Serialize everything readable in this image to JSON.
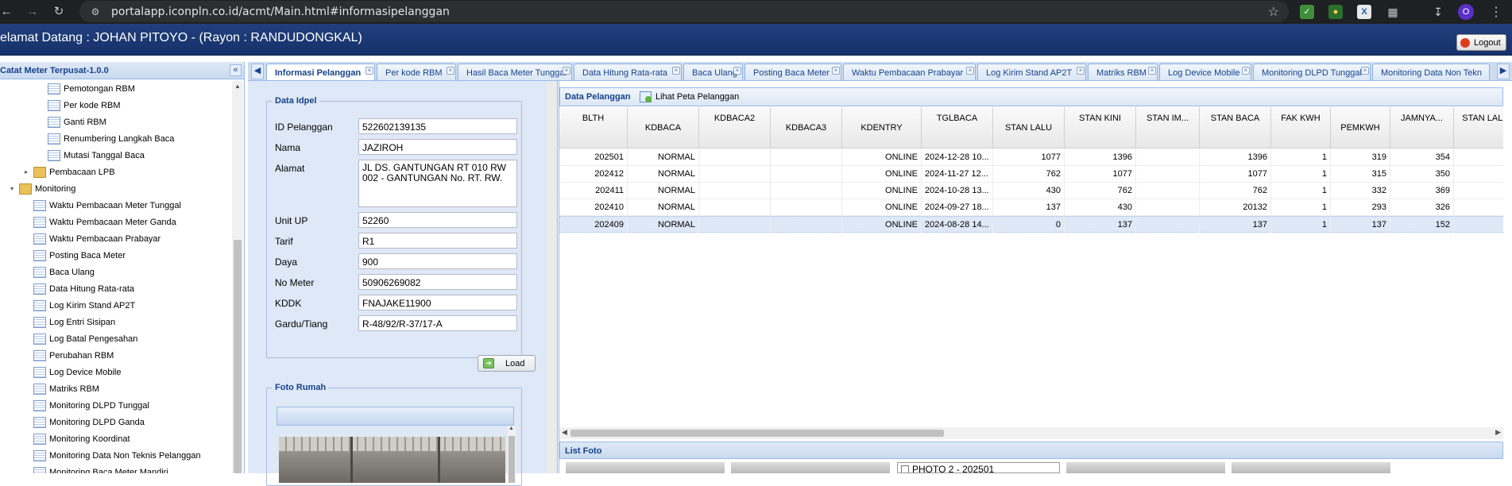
{
  "browser": {
    "url": "portalapp.iconpln.co.id/acmt/Main.html#informasipelanggan",
    "profile_initial": "O",
    "nav_icons": [
      "back-icon",
      "forward-icon",
      "reload-icon"
    ],
    "extension_icons": [
      "shield-extension-icon",
      "color-extension-icon",
      "excel-extension-icon",
      "puzzle-extension-icon",
      "download-icon"
    ]
  },
  "header": {
    "welcome": "elamat Datang : JOHAN PITOYO - (Rayon : RANDUDONGKAL)",
    "logout_label": "Logout"
  },
  "sidebar": {
    "title": "Catat Meter Terpusat-1.0.0",
    "items": [
      {
        "label": "Pemotongan RBM",
        "level": 2,
        "type": "leaf"
      },
      {
        "label": "Per kode RBM",
        "level": 2,
        "type": "leaf"
      },
      {
        "label": "Ganti RBM",
        "level": 2,
        "type": "leaf"
      },
      {
        "label": "Renumbering Langkah Baca",
        "level": 2,
        "type": "leaf"
      },
      {
        "label": "Mutasi Tanggal Baca",
        "level": 2,
        "type": "leaf"
      },
      {
        "label": "Pembacaan LPB",
        "level": 1,
        "type": "folder-collapsed"
      },
      {
        "label": "Monitoring",
        "level": 0,
        "type": "folder-open"
      },
      {
        "label": "Waktu Pembacaan Meter Tunggal",
        "level": 1,
        "type": "leaf"
      },
      {
        "label": "Waktu Pembacaan Meter Ganda",
        "level": 1,
        "type": "leaf"
      },
      {
        "label": "Waktu Pembacaan Prabayar",
        "level": 1,
        "type": "leaf"
      },
      {
        "label": "Posting Baca Meter",
        "level": 1,
        "type": "leaf"
      },
      {
        "label": "Baca Ulang",
        "level": 1,
        "type": "leaf"
      },
      {
        "label": "Data Hitung Rata-rata",
        "level": 1,
        "type": "leaf"
      },
      {
        "label": "Log Kirim Stand AP2T",
        "level": 1,
        "type": "leaf"
      },
      {
        "label": "Log Entri Sisipan",
        "level": 1,
        "type": "leaf"
      },
      {
        "label": "Log Batal Pengesahan",
        "level": 1,
        "type": "leaf"
      },
      {
        "label": "Perubahan RBM",
        "level": 1,
        "type": "leaf"
      },
      {
        "label": "Log Device Mobile",
        "level": 1,
        "type": "leaf"
      },
      {
        "label": "Matriks RBM",
        "level": 1,
        "type": "leaf"
      },
      {
        "label": "Monitoring DLPD Tunggal",
        "level": 1,
        "type": "leaf"
      },
      {
        "label": "Monitoring DLPD Ganda",
        "level": 1,
        "type": "leaf"
      },
      {
        "label": "Monitoring Koordinat",
        "level": 1,
        "type": "leaf"
      },
      {
        "label": "Monitoring Data Non Teknis Pelanggan",
        "level": 1,
        "type": "leaf"
      },
      {
        "label": "Monitoring Baca Meter Mandiri",
        "level": 1,
        "type": "leaf"
      }
    ]
  },
  "tabs": [
    {
      "label": "Informasi Pelanggan",
      "active": true
    },
    {
      "label": "Per kode RBM",
      "active": false
    },
    {
      "label": "Hasil Baca Meter Tunggal",
      "active": false
    },
    {
      "label": "Data Hitung Rata-rata",
      "active": false
    },
    {
      "label": "Baca Ulang",
      "active": false
    },
    {
      "label": "Posting Baca Meter",
      "active": false
    },
    {
      "label": "Waktu Pembacaan Prabayar",
      "active": false
    },
    {
      "label": "Log Kirim Stand AP2T",
      "active": false
    },
    {
      "label": "Matriks RBM",
      "active": false
    },
    {
      "label": "Log Device Mobile",
      "active": false
    },
    {
      "label": "Monitoring DLPD Tunggal",
      "active": false
    },
    {
      "label": "Monitoring Data Non Tekn",
      "active": false
    }
  ],
  "data_idpel": {
    "legend": "Data Idpel",
    "fields": [
      {
        "label": "ID Pelanggan",
        "value": "522602139135"
      },
      {
        "label": "Nama",
        "value": "JAZIROH"
      },
      {
        "label": "Alamat",
        "value": "JL DS. GANTUNGAN RT 010 RW 002 - GANTUNGAN No.   RT. RW."
      },
      {
        "label": "Unit UP",
        "value": "52260"
      },
      {
        "label": "Tarif",
        "value": "R1"
      },
      {
        "label": "Daya",
        "value": "900"
      },
      {
        "label": "No Meter",
        "value": "50906269082"
      },
      {
        "label": "KDDK",
        "value": "FNAJAKE11900"
      },
      {
        "label": "Gardu/Tiang",
        "value": "R-48/92/R-37/17-A"
      }
    ],
    "load_label": "Load"
  },
  "foto_rumah": {
    "legend": "Foto Rumah"
  },
  "grid": {
    "title": "Data Pelanggan",
    "map_button": "Lihat Peta Pelanggan",
    "columns": [
      "BLTH",
      "KDBACA",
      "KDBACA2",
      "KDBACA3",
      "KDENTRY",
      "TGLBACA",
      "STAN LALU",
      "STAN KINI",
      "STAN IM...",
      "STAN BACA",
      "FAK KWH",
      "PEMKWH",
      "JAMNYA...",
      "STAN LALU W"
    ],
    "rows": [
      [
        "202501",
        "NORMAL",
        "",
        "",
        "ONLINE",
        "2024-12-28 10...",
        "1077",
        "1396",
        "",
        "1396",
        "1",
        "319",
        "354",
        ""
      ],
      [
        "202412",
        "NORMAL",
        "",
        "",
        "ONLINE",
        "2024-11-27 12...",
        "762",
        "1077",
        "",
        "1077",
        "1",
        "315",
        "350",
        ""
      ],
      [
        "202411",
        "NORMAL",
        "",
        "",
        "ONLINE",
        "2024-10-28 13...",
        "430",
        "762",
        "",
        "762",
        "1",
        "332",
        "369",
        ""
      ],
      [
        "202410",
        "NORMAL",
        "",
        "",
        "ONLINE",
        "2024-09-27 18...",
        "137",
        "430",
        "",
        "20132",
        "1",
        "293",
        "326",
        ""
      ],
      [
        "202409",
        "NORMAL",
        "",
        "",
        "ONLINE",
        "2024-08-28 14...",
        "0",
        "137",
        "",
        "137",
        "1",
        "137",
        "152",
        ""
      ]
    ],
    "selected_row": 4
  },
  "list_foto": {
    "title": "List Foto",
    "photo2_label": "PHOTO 2 - 202501"
  }
}
